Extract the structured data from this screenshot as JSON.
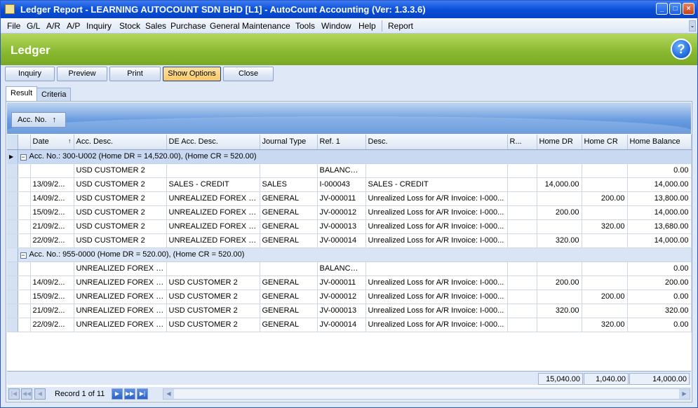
{
  "window": {
    "title": "Ledger Report - LEARNING AUTOCOUNT SDN BHD [L1] - AutoCount Accounting (Ver: 1.3.3.6)",
    "controls": [
      "_",
      "□",
      "×"
    ]
  },
  "menu": {
    "items": [
      "File",
      "G/L",
      "A/R",
      "A/P",
      "Inquiry",
      "Stock",
      "Sales",
      "Purchase",
      "General Maintenance",
      "Tools",
      "Window",
      "Help",
      "Report"
    ]
  },
  "header": {
    "title": "Ledger",
    "help_label": "?"
  },
  "toolbar": {
    "inquiry": "Inquiry",
    "preview": "Preview",
    "print": "Print",
    "show_options": "Show Options",
    "close": "Close"
  },
  "tabs": {
    "result": "Result",
    "criteria": "Criteria"
  },
  "group_panel": {
    "chip_label": "Acc. No.",
    "sort_icon": "↑"
  },
  "columns": [
    "Date",
    "Acc. Desc.",
    "DE Acc. Desc.",
    "Journal Type",
    "Ref. 1",
    "Desc.",
    "R...",
    "Home DR",
    "Home CR",
    "Home Balance"
  ],
  "groups": [
    {
      "label": "Acc. No.: 300-U002 (Home DR = 14,520.00), (Home CR = 520.00)",
      "rows": [
        [
          "",
          "USD CUSTOMER 2",
          "",
          "",
          "BALANCE ...",
          "",
          "",
          "",
          "",
          "0.00"
        ],
        [
          "13/09/2...",
          "USD CUSTOMER 2",
          "SALES - CREDIT",
          "SALES",
          "I-000043",
          "SALES - CREDIT",
          "",
          "14,000.00",
          "",
          "14,000.00"
        ],
        [
          "14/09/2...",
          "USD CUSTOMER 2",
          "UNREALIZED  FOREX L...",
          "GENERAL",
          "JV-000011",
          "Unrealized Loss for A/R Invoice: I-000...",
          "",
          "",
          "200.00",
          "13,800.00"
        ],
        [
          "15/09/2...",
          "USD CUSTOMER 2",
          "UNREALIZED  FOREX L...",
          "GENERAL",
          "JV-000012",
          "Unrealized Loss for A/R Invoice: I-000...",
          "",
          "200.00",
          "",
          "14,000.00"
        ],
        [
          "21/09/2...",
          "USD CUSTOMER 2",
          "UNREALIZED  FOREX L...",
          "GENERAL",
          "JV-000013",
          "Unrealized Loss for A/R Invoice: I-000...",
          "",
          "",
          "320.00",
          "13,680.00"
        ],
        [
          "22/09/2...",
          "USD CUSTOMER 2",
          "UNREALIZED  FOREX L...",
          "GENERAL",
          "JV-000014",
          "Unrealized Loss for A/R Invoice: I-000...",
          "",
          "320.00",
          "",
          "14,000.00"
        ]
      ]
    },
    {
      "label": "Acc. No.: 955-0000 (Home DR = 520.00), (Home CR = 520.00)",
      "rows": [
        [
          "",
          "UNREALIZED  FOREX L...",
          "",
          "",
          "BALANCE ...",
          "",
          "",
          "",
          "",
          "0.00"
        ],
        [
          "14/09/2...",
          "UNREALIZED  FOREX L...",
          "USD CUSTOMER 2",
          "GENERAL",
          "JV-000011",
          "Unrealized Loss for A/R Invoice: I-000...",
          "",
          "200.00",
          "",
          "200.00"
        ],
        [
          "15/09/2...",
          "UNREALIZED  FOREX L...",
          "USD CUSTOMER 2",
          "GENERAL",
          "JV-000012",
          "Unrealized Loss for A/R Invoice: I-000...",
          "",
          "",
          "200.00",
          "0.00"
        ],
        [
          "21/09/2...",
          "UNREALIZED  FOREX L...",
          "USD CUSTOMER 2",
          "GENERAL",
          "JV-000013",
          "Unrealized Loss for A/R Invoice: I-000...",
          "",
          "320.00",
          "",
          "320.00"
        ],
        [
          "22/09/2...",
          "UNREALIZED  FOREX L...",
          "USD CUSTOMER 2",
          "GENERAL",
          "JV-000014",
          "Unrealized Loss for A/R Invoice: I-000...",
          "",
          "",
          "320.00",
          "0.00"
        ]
      ]
    }
  ],
  "totals": {
    "home_dr": "15,040.00",
    "home_cr": "1,040.00",
    "home_balance": "14,000.00"
  },
  "navigator": {
    "record_text": "Record 1 of 11"
  }
}
